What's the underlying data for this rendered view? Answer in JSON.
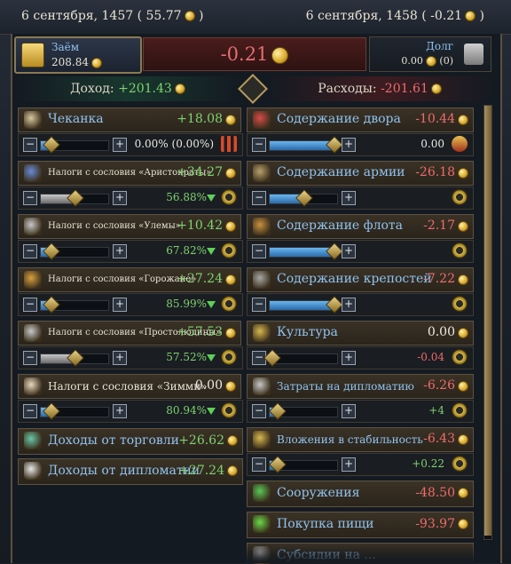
{
  "top": {
    "date_left_text": "6 сентября, 1457 ( 55.77",
    "date_left_close": " )",
    "date_right_text": "6 сентября, 1458 ( -0.21",
    "date_right_close": " )"
  },
  "loan": {
    "title": "Заём",
    "value": "208.84"
  },
  "balance": {
    "value": "-0.21"
  },
  "debt": {
    "title": "Долг",
    "value": "0.00",
    "count": "(0)"
  },
  "income": {
    "label": "Доход:",
    "value": "+201.43"
  },
  "expenses": {
    "label": "Расходы:",
    "value": "-201.61"
  },
  "income_rows": [
    {
      "label": "Чеканка",
      "value": "+18.08",
      "sub_value": "0.00% (0.00%)",
      "slider": 0.15,
      "icon": "hammer-icon"
    },
    {
      "label": "Налоги с сословия «Аристократы»",
      "value": "+34.27",
      "sub_value": "56.88%",
      "slider": 0.5,
      "icon": "estate-nobles-icon"
    },
    {
      "label": "Налоги с сословия «Улемы»",
      "value": "+10.42",
      "sub_value": "67.82%",
      "slider": 0.15,
      "icon": "estate-clergy-icon"
    },
    {
      "label": "Налоги с сословия «Горожане»",
      "value": "+27.24",
      "sub_value": "85.99%",
      "slider": 0.15,
      "icon": "estate-burghers-icon"
    },
    {
      "label": "Налоги с сословия «Простолюдины»",
      "value": "+57.53",
      "sub_value": "57.52%",
      "slider": 0.5,
      "icon": "estate-peasants-icon"
    },
    {
      "label": "Налоги с сословия «Зимми»",
      "value": "0.00",
      "sub_value": "80.94%",
      "slider": 0.15,
      "icon": "estate-dhimmi-icon"
    }
  ],
  "trade": {
    "label": "Доходы от торговли",
    "value": "+26.62"
  },
  "diplomacy_income": {
    "label": "Доходы от дипломатии",
    "value": "+27.24"
  },
  "expense_rows": [
    {
      "label": "Содержание двора",
      "value": "-10.44",
      "sub_value": "0.00",
      "slider": 0.95,
      "icon": "court-icon"
    },
    {
      "label": "Содержание армии",
      "value": "-26.18",
      "sub_value": "",
      "slider": 0.5,
      "icon": "army-icon"
    },
    {
      "label": "Содержание флота",
      "value": "-2.17",
      "sub_value": "",
      "slider": 0.95,
      "icon": "navy-icon"
    },
    {
      "label": "Содержание крепостей",
      "value": "-7.22",
      "sub_value": "",
      "slider": 0.95,
      "icon": "fort-icon"
    },
    {
      "label": "Культура",
      "value": "0.00",
      "sub_value": "-0.04",
      "slider": 0.0,
      "icon": "culture-icon"
    },
    {
      "label": "Затраты на дипломатию",
      "value": "-6.26",
      "sub_value": "+4",
      "slider": 0.1,
      "icon": "diplomacy-icon"
    },
    {
      "label": "Вложения в стабильность",
      "value": "-6.43",
      "sub_value": "+0.22",
      "slider": 0.1,
      "icon": "stability-icon"
    }
  ],
  "buildings": {
    "label": "Сооружения",
    "value": "-48.50"
  },
  "food": {
    "label": "Покупка пищи",
    "value": "-93.97"
  },
  "last_row": {
    "label": "Субсидии на ..."
  }
}
